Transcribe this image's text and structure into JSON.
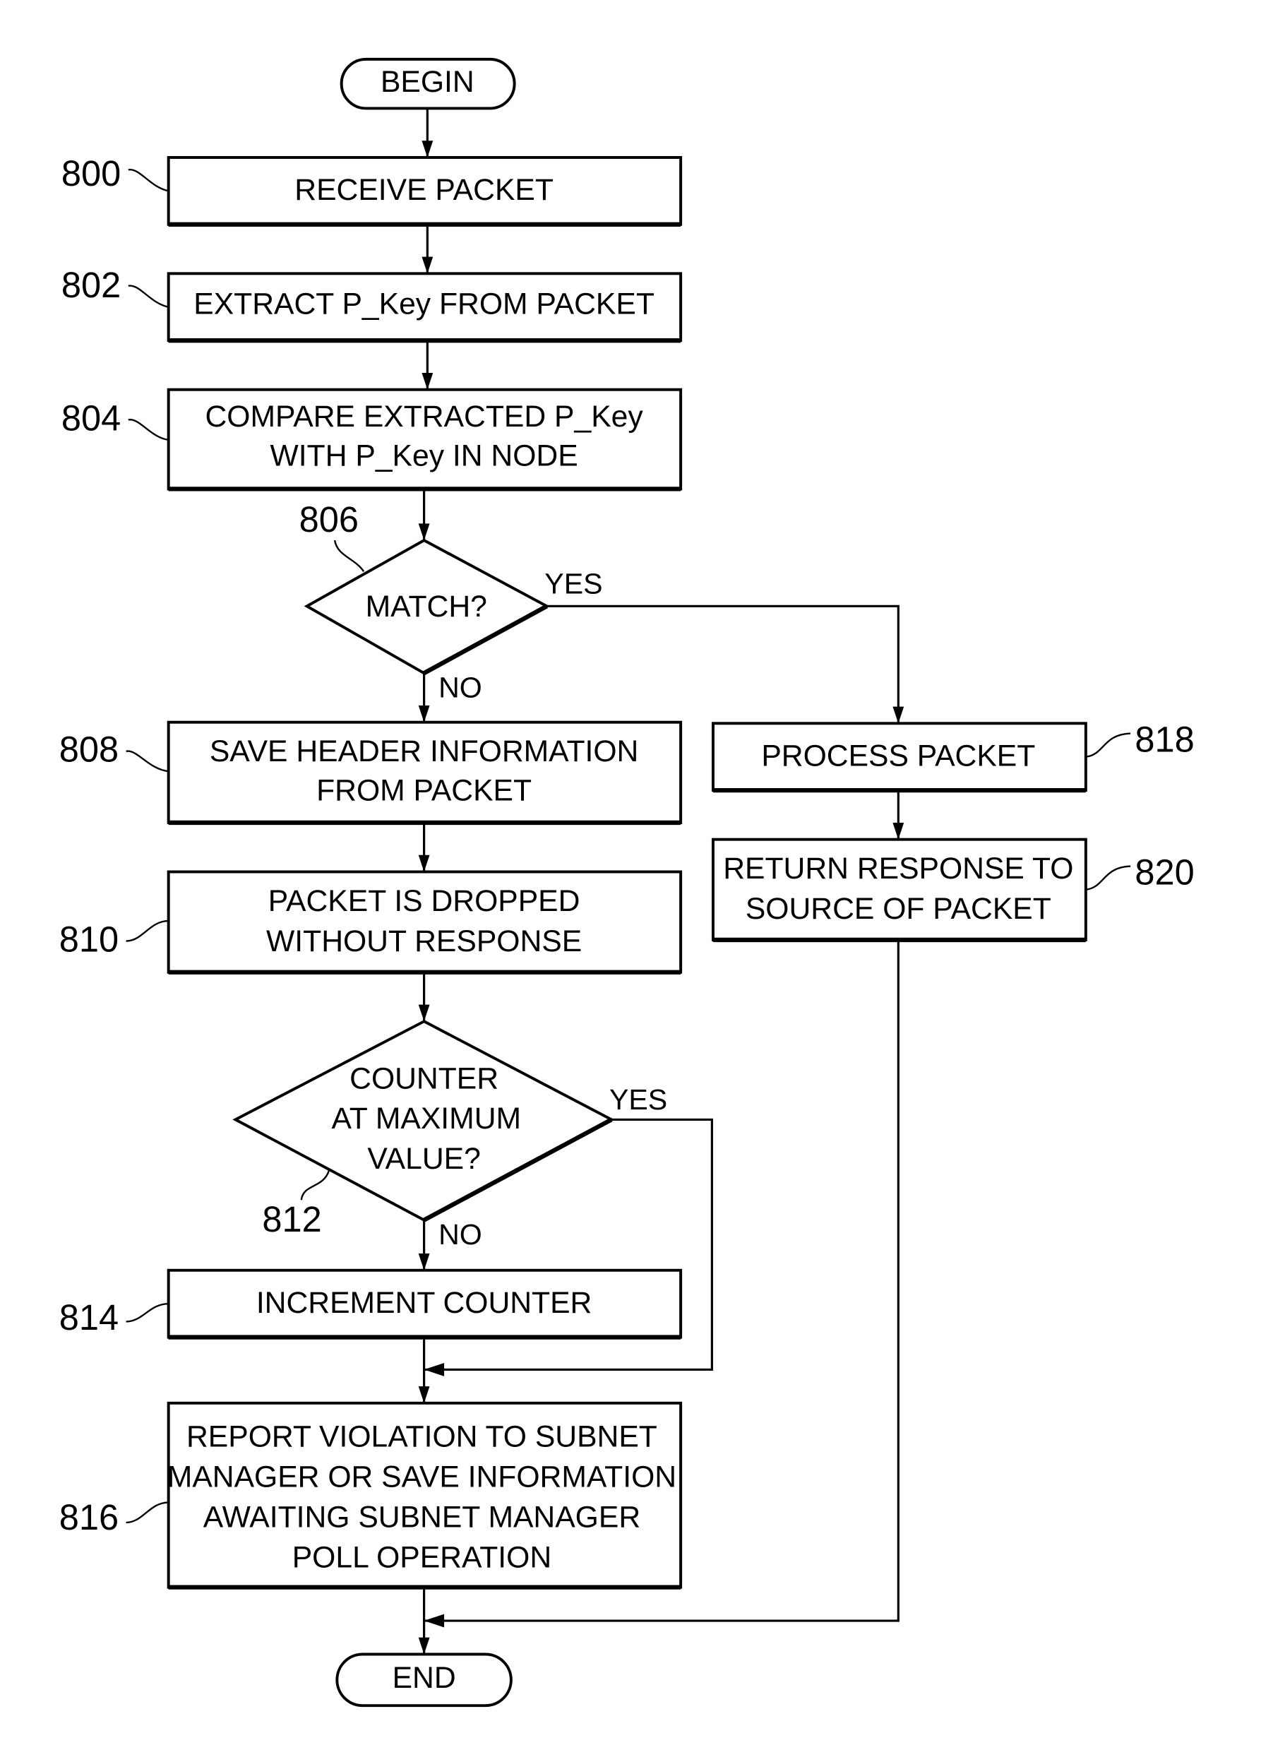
{
  "figure": {
    "terminals": {
      "begin": "BEGIN",
      "end": "END"
    },
    "steps": {
      "s800": {
        "ref": "800",
        "lines": [
          "RECEIVE  PACKET"
        ]
      },
      "s802": {
        "ref": "802",
        "lines": [
          "EXTRACT  P_Key  FROM  PACKET"
        ]
      },
      "s804": {
        "ref": "804",
        "lines": [
          "COMPARE  EXTRACTED  P_Key",
          "WITH  P_Key  IN  NODE"
        ]
      },
      "s806": {
        "ref": "806",
        "lines": [
          "MATCH?"
        ],
        "yes": "YES",
        "no": "NO"
      },
      "s808": {
        "ref": "808",
        "lines": [
          "SAVE  HEADER  INFORMATION",
          "FROM  PACKET"
        ]
      },
      "s810": {
        "ref": "810",
        "lines": [
          "PACKET  IS  DROPPED",
          "WITHOUT  RESPONSE"
        ]
      },
      "s812": {
        "ref": "812",
        "lines": [
          "COUNTER",
          "AT  MAXIMUM",
          "VALUE?"
        ],
        "yes": "YES",
        "no": "NO"
      },
      "s814": {
        "ref": "814",
        "lines": [
          "INCREMENT  COUNTER"
        ]
      },
      "s816": {
        "ref": "816",
        "lines": [
          "REPORT  VIOLATION  TO  SUBNET",
          "MANAGER  OR  SAVE  INFORMATION",
          "AWAITING  SUBNET  MANAGER",
          "POLL  OPERATION"
        ]
      },
      "s818": {
        "ref": "818",
        "lines": [
          "PROCESS  PACKET"
        ]
      },
      "s820": {
        "ref": "820",
        "lines": [
          "RETURN  RESPONSE  TO",
          "SOURCE  OF  PACKET"
        ]
      }
    }
  }
}
